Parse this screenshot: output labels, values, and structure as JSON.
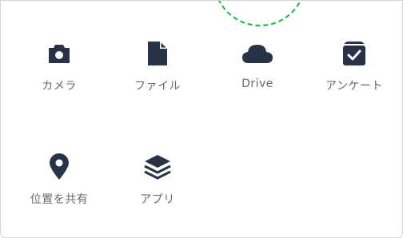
{
  "accent_color": "#21b24b",
  "icon_color": "#283347",
  "label_color": "#666a70",
  "menu": {
    "items": [
      {
        "label": "カメラ",
        "icon": "camera-icon"
      },
      {
        "label": "ファイル",
        "icon": "file-icon"
      },
      {
        "label": "Drive",
        "icon": "cloud-icon"
      },
      {
        "label": "アンケート",
        "icon": "survey-box-icon"
      },
      {
        "label": "位置を共有",
        "icon": "location-pin-icon"
      },
      {
        "label": "アプリ",
        "icon": "layers-icon"
      }
    ]
  }
}
